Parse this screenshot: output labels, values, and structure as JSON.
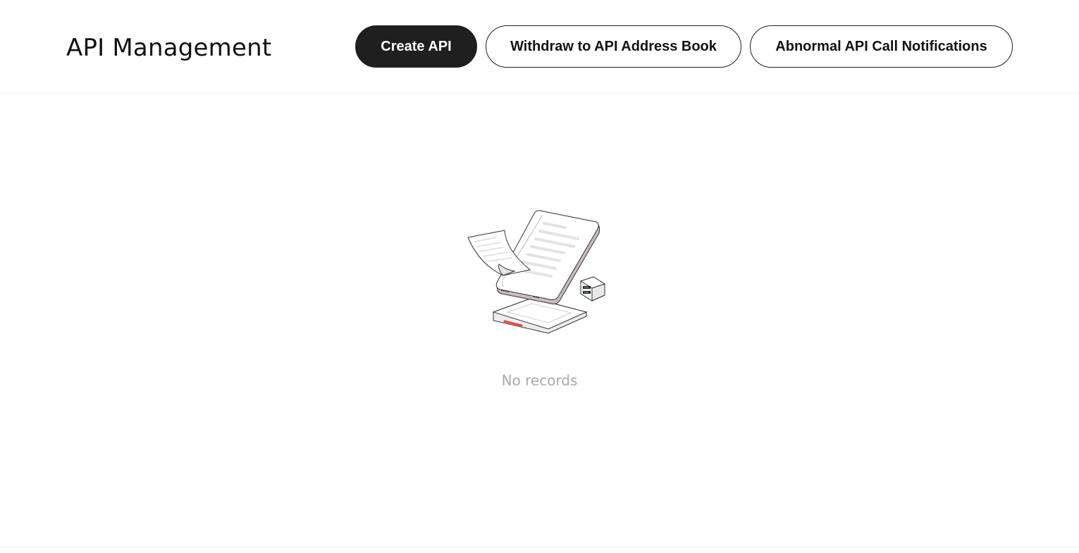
{
  "header": {
    "title": "API Management",
    "buttons": {
      "create": "Create API",
      "withdraw": "Withdraw to API Address Book",
      "abnormal": "Abnormal API Call Notifications"
    }
  },
  "empty_state": {
    "message": "No records",
    "illustration": "empty-documents-illustration"
  },
  "colors": {
    "primary_button": "#1f1f1f",
    "accent_red": "#e84c3d",
    "muted_text": "#a9a9a9"
  }
}
